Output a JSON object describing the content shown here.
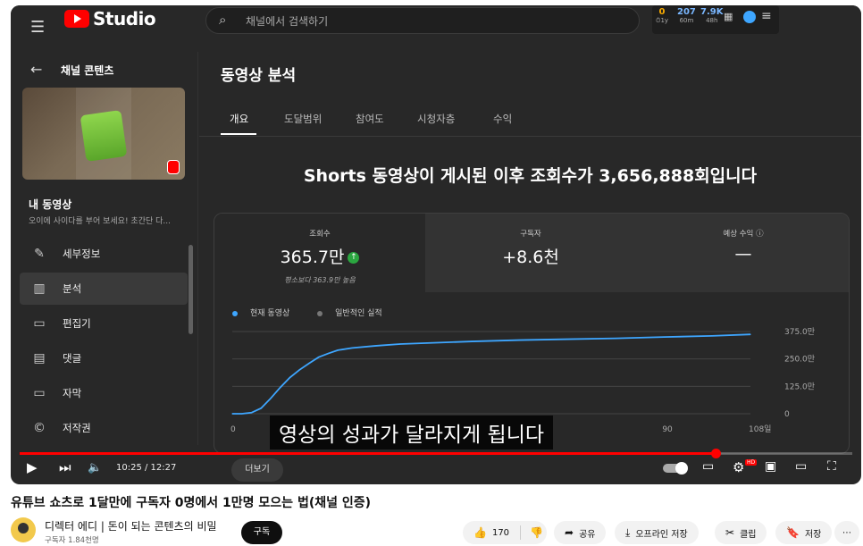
{
  "header": {
    "logo_text": "Studio",
    "search_placeholder": "채널에서 검색하기",
    "stats": [
      {
        "value": "0",
        "label": "⏱1y",
        "color": "#f9ab00"
      },
      {
        "value": "207",
        "label": "60m",
        "color": "#7ab7ff"
      },
      {
        "value": "7.9K",
        "label": "48h",
        "color": "#7ab7ff"
      }
    ]
  },
  "sidebar": {
    "title": "채널 콘텐츠",
    "video_title": "내 동영상",
    "video_desc": "오이에 사이다를 부어 보세요! 초간단 다...",
    "items": [
      {
        "label": "세부정보",
        "icon": "pencil-icon",
        "glyph": "✎"
      },
      {
        "label": "분석",
        "icon": "analytics-icon",
        "glyph": "▥",
        "active": true
      },
      {
        "label": "편집기",
        "icon": "editor-icon",
        "glyph": "🎞"
      },
      {
        "label": "댓글",
        "icon": "comments-icon",
        "glyph": "▤"
      },
      {
        "label": "자막",
        "icon": "subtitles-icon",
        "glyph": "▭"
      },
      {
        "label": "저작권",
        "icon": "copyright-icon",
        "glyph": "©"
      }
    ]
  },
  "main": {
    "title": "동영상 분석",
    "tabs": [
      "개요",
      "도달범위",
      "참여도",
      "시청자층",
      "수익"
    ],
    "headline": "Shorts 동영상이 게시된 이후 조회수가 3,656,888회입니다",
    "metrics": [
      {
        "label": "조회수",
        "value": "365.7만",
        "sub": "평소보다 363.9만 높음"
      },
      {
        "label": "구독자",
        "value": "+8.6천",
        "sub": ""
      },
      {
        "label": "예상 수익",
        "value": "—",
        "sub": ""
      }
    ],
    "legend": {
      "current": "현재 동영상",
      "typical": "일반적인 실적"
    },
    "more_button": "더보기"
  },
  "chart_data": {
    "type": "line",
    "series": [
      {
        "name": "현재 동영상",
        "color": "#3ea6ff",
        "x": [
          0,
          2,
          4,
          6,
          8,
          10,
          12,
          14,
          16,
          18,
          20,
          22,
          25,
          30,
          35,
          40,
          50,
          60,
          70,
          80,
          90,
          100,
          108
        ],
        "values": [
          0,
          0,
          5,
          25,
          70,
          120,
          165,
          200,
          230,
          258,
          275,
          290,
          300,
          310,
          318,
          322,
          330,
          336,
          340,
          344,
          350,
          355,
          362
        ]
      }
    ],
    "x_tick_labels": [
      "0",
      "90",
      "108일"
    ],
    "y_tick_labels": [
      "375.0만",
      "250.0만",
      "125.0만",
      "0"
    ],
    "xlim": [
      0,
      108
    ],
    "ylim": [
      0,
      375
    ],
    "grid": true
  },
  "player": {
    "caption": "영상의 성과가 달라지게 됩니다",
    "time": "10:25 / 12:27",
    "progress": 0.836,
    "hd_badge": "HD"
  },
  "video": {
    "title": "유튜브 쇼츠로 1달만에 구독자 0명에서 1만명 모으는 법(채널 인증)",
    "channel": "디렉터 에디 | 돈이 되는 콘텐츠의 비밀",
    "subscribers": "구독자 1.84천명",
    "subscribe": "구독",
    "likes": "170",
    "share": "공유",
    "offline": "오프라인 저장",
    "clip": "클립",
    "save": "저장",
    "more": "⋯"
  },
  "colors": {
    "accent": "#ff0000",
    "line": "#3ea6ff",
    "up": "#2ba640"
  }
}
